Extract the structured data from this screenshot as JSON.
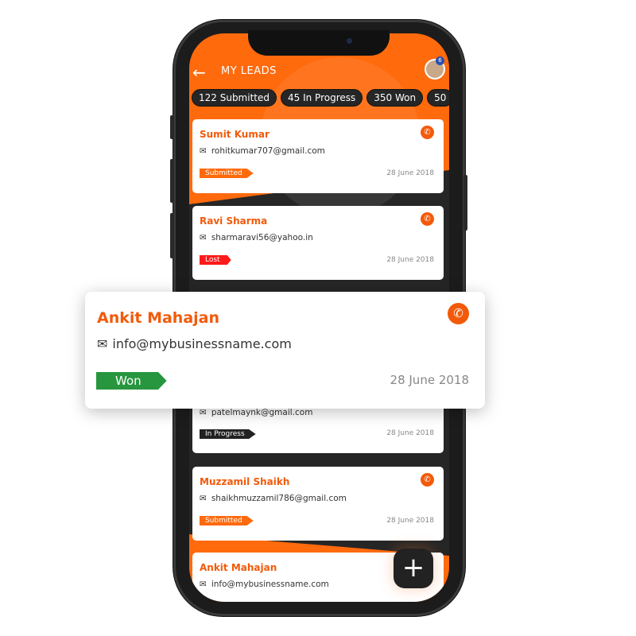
{
  "header": {
    "title": "MY LEADS",
    "badge_count": "6",
    "back_icon": "arrow-left-icon"
  },
  "chips": [
    "122 Submitted",
    "45 In Progress",
    "350 Won",
    "50"
  ],
  "colors": {
    "accent": "#ff6a0d",
    "won": "#27963e",
    "lost": "#ff1a1a",
    "in_progress": "#222222",
    "dark": "#262626"
  },
  "leads": [
    {
      "name": "Sumit Kumar",
      "email": "rohitkumar707@gmail.com",
      "status": "Submitted",
      "date": "28 June 2018",
      "color": "#ff6a0d"
    },
    {
      "name": "Ravi Sharma",
      "email": "sharmaravi56@yahoo.in",
      "status": "Lost",
      "date": "28 June 2018",
      "color": "#ff1a1a"
    },
    {
      "name": "",
      "email": "patelmaynk@gmail.com",
      "status": "In Progress",
      "date": "28 June 2018",
      "color": "#222222"
    },
    {
      "name": "Muzzamil Shaikh",
      "email": "shaikhmuzzamil786@gmail.com",
      "status": "Submitted",
      "date": "28 June 2018",
      "color": "#ff6a0d"
    },
    {
      "name": "Ankit Mahajan",
      "email": "info@mybusinessname.com",
      "status": "",
      "date": "",
      "color": "#ff6a0d"
    }
  ],
  "featured": {
    "name": "Ankit Mahajan",
    "email": "info@mybusinessname.com",
    "status": "Won",
    "date": "28 June 2018"
  },
  "fab": {
    "label": "+"
  }
}
